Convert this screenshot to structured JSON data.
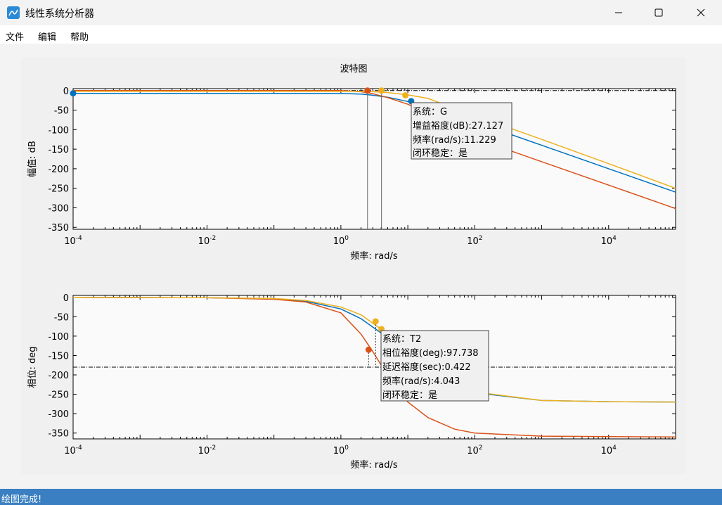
{
  "window": {
    "title": "线性系统分析器"
  },
  "menu": {
    "file": "文件",
    "edit": "编辑",
    "help": "帮助"
  },
  "figure": {
    "title": "波特图"
  },
  "magnitude_plot": {
    "ylabel": "幅值: dB",
    "xlabel": "频率: rad/s",
    "yticks": [
      "0",
      "-50",
      "-100",
      "-150",
      "-200",
      "-250",
      "-300",
      "-350"
    ],
    "xticks": [
      {
        "base": "10",
        "exp": "-4"
      },
      {
        "base": "10",
        "exp": "-2"
      },
      {
        "base": "10",
        "exp": "0"
      },
      {
        "base": "10",
        "exp": "2"
      },
      {
        "base": "10",
        "exp": "4"
      }
    ],
    "tooltip": [
      "系统：G",
      "增益裕度(dB):27.127",
      "频率(rad/s):11.229",
      "闭环稳定：是"
    ]
  },
  "phase_plot": {
    "ylabel": "相位: deg",
    "xlabel": "频率: rad/s",
    "yticks": [
      "0",
      "-50",
      "-100",
      "-150",
      "-200",
      "-250",
      "-300",
      "-350"
    ],
    "xticks": [
      {
        "base": "10",
        "exp": "-4"
      },
      {
        "base": "10",
        "exp": "-2"
      },
      {
        "base": "10",
        "exp": "0"
      },
      {
        "base": "10",
        "exp": "2"
      },
      {
        "base": "10",
        "exp": "4"
      }
    ],
    "tooltip": [
      "系统：T2",
      "相位裕度(deg):97.738",
      "延迟裕度(sec):0.422",
      "频率(rad/s):4.043",
      "闭环稳定：是"
    ]
  },
  "status": {
    "text": "绘图完成!"
  },
  "colors": {
    "blue": "#0072bd",
    "orange": "#d95319",
    "yellow": "#edb120",
    "accent": "#3a7fc1"
  },
  "chart_data": [
    {
      "type": "line",
      "title": "波特图",
      "xlabel": "频率: rad/s",
      "ylabel": "幅值: dB",
      "xscale": "log",
      "xlim": [
        0.0001,
        100000
      ],
      "ylim": [
        -355,
        5
      ],
      "series": [
        {
          "x": [
            0.0001,
            0.01,
            1,
            2,
            3,
            5,
            10,
            20,
            50,
            100,
            1000,
            10000,
            100000
          ],
          "y": [
            -7,
            -7,
            -7.5,
            -9,
            -12,
            -17,
            -28,
            -42,
            -62,
            -80,
            -140,
            -200,
            -260
          ]
        },
        {
          "x": [
            0.0001,
            0.01,
            1,
            2,
            3,
            5,
            10,
            20,
            50,
            100,
            1000,
            10000,
            100000
          ],
          "y": [
            0,
            0,
            0,
            -3,
            -8,
            -18,
            -35,
            -58,
            -94,
            -122,
            -182,
            -242,
            -302
          ]
        },
        {
          "x": [
            0.0001,
            0.01,
            1,
            2,
            3,
            5,
            10,
            20,
            50,
            100,
            1000,
            10000,
            100000
          ],
          "y": [
            -2,
            -2,
            -2,
            -2,
            -3,
            -5,
            -11,
            -20,
            -46,
            -64,
            -125,
            -187,
            -250
          ]
        }
      ],
      "markers": [
        {
          "x": 0.0001,
          "y": -7
        },
        {
          "x": 11.229,
          "y": -27.127
        },
        {
          "x": 2.5,
          "y": 0
        },
        {
          "x": 4.043,
          "y": 0
        },
        {
          "x": 9.2,
          "y": -12
        }
      ],
      "reference_line": {
        "y": 0,
        "style": "dash-dot"
      }
    },
    {
      "type": "line",
      "xlabel": "频率: rad/s",
      "ylabel": "相位: deg",
      "xscale": "log",
      "xlim": [
        0.0001,
        100000
      ],
      "ylim": [
        -365,
        5
      ],
      "series": [
        {
          "x": [
            0.0001,
            0.01,
            0.1,
            0.3,
            1,
            2,
            4,
            8,
            20,
            50,
            100,
            1000,
            10000,
            100000
          ],
          "y": [
            0,
            -1,
            -4,
            -10,
            -30,
            -55,
            -92,
            -135,
            -185,
            -225,
            -246,
            -266,
            -269,
            -270
          ]
        },
        {
          "x": [
            0.0001,
            0.01,
            0.1,
            0.3,
            1,
            2,
            3,
            4,
            6,
            10,
            20,
            50,
            100,
            1000,
            10000,
            100000
          ],
          "y": [
            0,
            -1,
            -5,
            -12,
            -40,
            -95,
            -140,
            -175,
            -220,
            -270,
            -310,
            -340,
            -350,
            -358,
            -359,
            -360
          ]
        },
        {
          "x": [
            0.0001,
            0.01,
            0.1,
            0.3,
            1,
            2,
            4,
            8,
            20,
            50,
            100,
            1000,
            10000,
            100000
          ],
          "y": [
            0,
            -1,
            -3,
            -8,
            -25,
            -45,
            -82,
            -120,
            -170,
            -220,
            -244,
            -266,
            -269,
            -270
          ]
        }
      ],
      "markers": [
        {
          "x": 2.6,
          "y": -135
        },
        {
          "x": 3.3,
          "y": -62
        },
        {
          "x": 4.043,
          "y": -82
        }
      ],
      "reference_line": {
        "y": -180,
        "style": "dash-dot"
      }
    }
  ]
}
